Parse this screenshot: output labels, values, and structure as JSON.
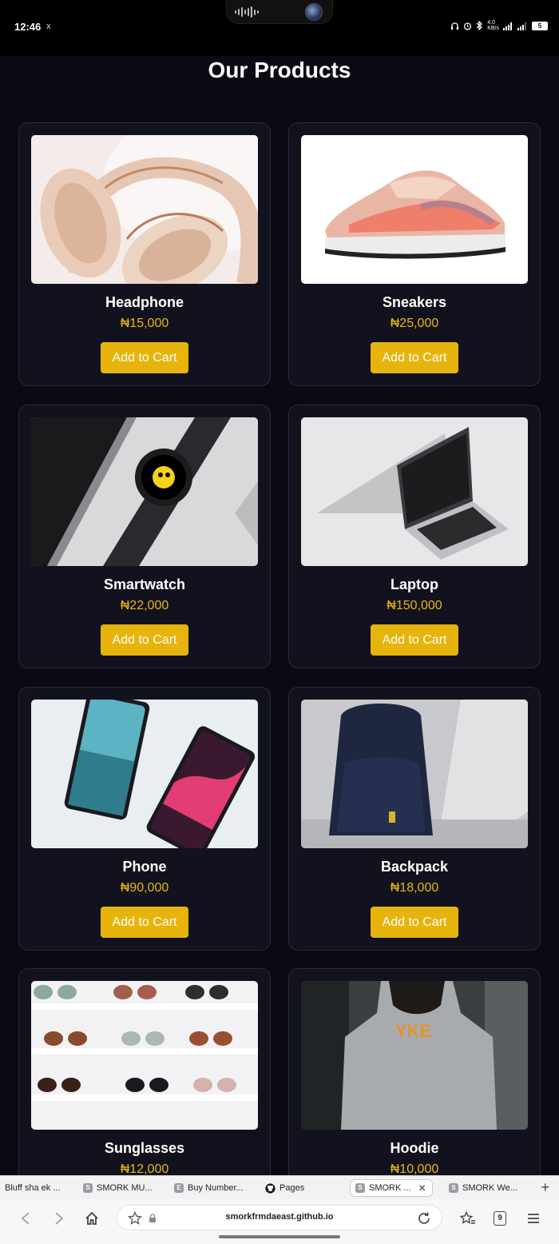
{
  "status": {
    "time": "12:46",
    "extra": "x",
    "battery": "5"
  },
  "page": {
    "title": "Our Products"
  },
  "button_label": "Add to Cart",
  "products": [
    {
      "name": "Headphone",
      "price": "₦15,000"
    },
    {
      "name": "Sneakers",
      "price": "₦25,000"
    },
    {
      "name": "Smartwatch",
      "price": "₦22,000"
    },
    {
      "name": "Laptop",
      "price": "₦150,000"
    },
    {
      "name": "Phone",
      "price": "₦90,000"
    },
    {
      "name": "Backpack",
      "price": "₦18,000"
    },
    {
      "name": "Sunglasses",
      "price": "₦12,000"
    },
    {
      "name": "Hoodie",
      "price": "₦10,000"
    }
  ],
  "tabs": [
    {
      "label": "Bluff sha ek ...",
      "icon": ""
    },
    {
      "label": "SMORK MU...",
      "icon": "S"
    },
    {
      "label": "Buy Number...",
      "icon": "E"
    },
    {
      "label": "Pages",
      "icon": "github"
    },
    {
      "label": "SMORK ...",
      "icon": "S",
      "active": true
    },
    {
      "label": "SMORK We...",
      "icon": "S"
    }
  ],
  "browser": {
    "url": "smorkfrmdaeast.github.io",
    "tab_count": "9"
  },
  "colors": {
    "background": "#0a0a14",
    "card": "#12121e",
    "accent": "#e6b40c",
    "price": "#e8b80f"
  }
}
